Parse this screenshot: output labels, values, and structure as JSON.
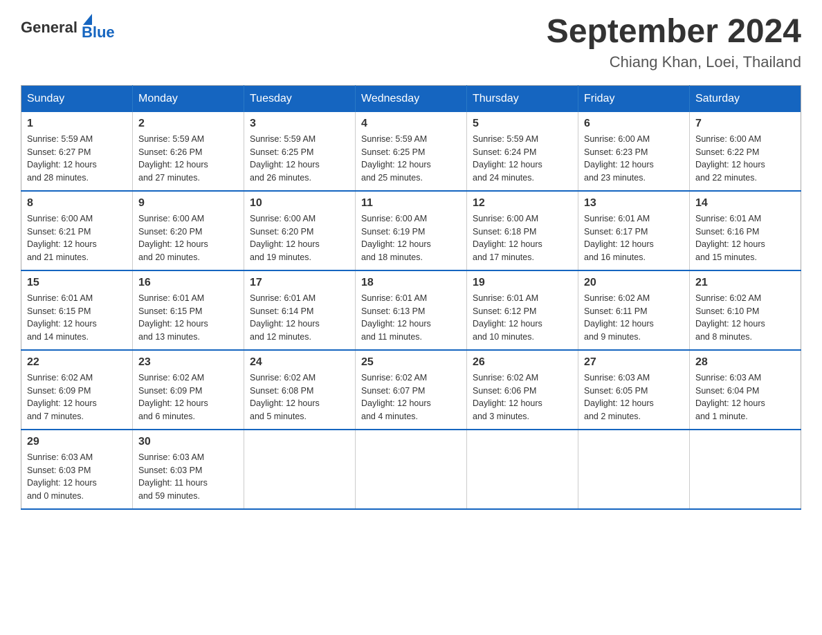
{
  "logo": {
    "text_general": "General",
    "text_blue": "Blue"
  },
  "header": {
    "month_year": "September 2024",
    "location": "Chiang Khan, Loei, Thailand"
  },
  "days_of_week": [
    "Sunday",
    "Monday",
    "Tuesday",
    "Wednesday",
    "Thursday",
    "Friday",
    "Saturday"
  ],
  "weeks": [
    [
      {
        "day": "1",
        "sunrise": "5:59 AM",
        "sunset": "6:27 PM",
        "daylight": "12 hours and 28 minutes."
      },
      {
        "day": "2",
        "sunrise": "5:59 AM",
        "sunset": "6:26 PM",
        "daylight": "12 hours and 27 minutes."
      },
      {
        "day": "3",
        "sunrise": "5:59 AM",
        "sunset": "6:25 PM",
        "daylight": "12 hours and 26 minutes."
      },
      {
        "day": "4",
        "sunrise": "5:59 AM",
        "sunset": "6:25 PM",
        "daylight": "12 hours and 25 minutes."
      },
      {
        "day": "5",
        "sunrise": "5:59 AM",
        "sunset": "6:24 PM",
        "daylight": "12 hours and 24 minutes."
      },
      {
        "day": "6",
        "sunrise": "6:00 AM",
        "sunset": "6:23 PM",
        "daylight": "12 hours and 23 minutes."
      },
      {
        "day": "7",
        "sunrise": "6:00 AM",
        "sunset": "6:22 PM",
        "daylight": "12 hours and 22 minutes."
      }
    ],
    [
      {
        "day": "8",
        "sunrise": "6:00 AM",
        "sunset": "6:21 PM",
        "daylight": "12 hours and 21 minutes."
      },
      {
        "day": "9",
        "sunrise": "6:00 AM",
        "sunset": "6:20 PM",
        "daylight": "12 hours and 20 minutes."
      },
      {
        "day": "10",
        "sunrise": "6:00 AM",
        "sunset": "6:20 PM",
        "daylight": "12 hours and 19 minutes."
      },
      {
        "day": "11",
        "sunrise": "6:00 AM",
        "sunset": "6:19 PM",
        "daylight": "12 hours and 18 minutes."
      },
      {
        "day": "12",
        "sunrise": "6:00 AM",
        "sunset": "6:18 PM",
        "daylight": "12 hours and 17 minutes."
      },
      {
        "day": "13",
        "sunrise": "6:01 AM",
        "sunset": "6:17 PM",
        "daylight": "12 hours and 16 minutes."
      },
      {
        "day": "14",
        "sunrise": "6:01 AM",
        "sunset": "6:16 PM",
        "daylight": "12 hours and 15 minutes."
      }
    ],
    [
      {
        "day": "15",
        "sunrise": "6:01 AM",
        "sunset": "6:15 PM",
        "daylight": "12 hours and 14 minutes."
      },
      {
        "day": "16",
        "sunrise": "6:01 AM",
        "sunset": "6:15 PM",
        "daylight": "12 hours and 13 minutes."
      },
      {
        "day": "17",
        "sunrise": "6:01 AM",
        "sunset": "6:14 PM",
        "daylight": "12 hours and 12 minutes."
      },
      {
        "day": "18",
        "sunrise": "6:01 AM",
        "sunset": "6:13 PM",
        "daylight": "12 hours and 11 minutes."
      },
      {
        "day": "19",
        "sunrise": "6:01 AM",
        "sunset": "6:12 PM",
        "daylight": "12 hours and 10 minutes."
      },
      {
        "day": "20",
        "sunrise": "6:02 AM",
        "sunset": "6:11 PM",
        "daylight": "12 hours and 9 minutes."
      },
      {
        "day": "21",
        "sunrise": "6:02 AM",
        "sunset": "6:10 PM",
        "daylight": "12 hours and 8 minutes."
      }
    ],
    [
      {
        "day": "22",
        "sunrise": "6:02 AM",
        "sunset": "6:09 PM",
        "daylight": "12 hours and 7 minutes."
      },
      {
        "day": "23",
        "sunrise": "6:02 AM",
        "sunset": "6:09 PM",
        "daylight": "12 hours and 6 minutes."
      },
      {
        "day": "24",
        "sunrise": "6:02 AM",
        "sunset": "6:08 PM",
        "daylight": "12 hours and 5 minutes."
      },
      {
        "day": "25",
        "sunrise": "6:02 AM",
        "sunset": "6:07 PM",
        "daylight": "12 hours and 4 minutes."
      },
      {
        "day": "26",
        "sunrise": "6:02 AM",
        "sunset": "6:06 PM",
        "daylight": "12 hours and 3 minutes."
      },
      {
        "day": "27",
        "sunrise": "6:03 AM",
        "sunset": "6:05 PM",
        "daylight": "12 hours and 2 minutes."
      },
      {
        "day": "28",
        "sunrise": "6:03 AM",
        "sunset": "6:04 PM",
        "daylight": "12 hours and 1 minute."
      }
    ],
    [
      {
        "day": "29",
        "sunrise": "6:03 AM",
        "sunset": "6:03 PM",
        "daylight": "12 hours and 0 minutes."
      },
      {
        "day": "30",
        "sunrise": "6:03 AM",
        "sunset": "6:03 PM",
        "daylight": "11 hours and 59 minutes."
      },
      null,
      null,
      null,
      null,
      null
    ]
  ],
  "labels": {
    "sunrise_prefix": "Sunrise: ",
    "sunset_prefix": "Sunset: ",
    "daylight_prefix": "Daylight: "
  }
}
